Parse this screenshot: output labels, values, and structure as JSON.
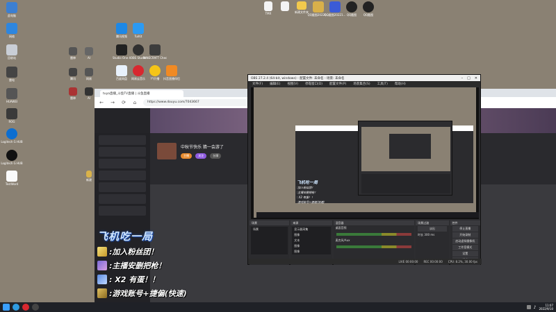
{
  "browser": {
    "tab_title": "tuya直播_斗鱼TV直播 | 斗鱼直播",
    "url": "https://www.douyu.com/7043667",
    "streamer_title": "中秋节快乐 猜一会游了",
    "pills": [
      "主播",
      "关注",
      "分享"
    ]
  },
  "overlay": {
    "title": "飞机吃一局",
    "lines": [
      ":加入粉丝团！",
      ":主播安删把枪！",
      ": X2 有蛋！！",
      ":游戏账号+捷偏(快速)"
    ]
  },
  "obs": {
    "window_title": "OBS 27.2.4 (64-bit, windows) - 配置文件: 未命名 - 场景: 未命名",
    "menu": [
      "文件(F)",
      "编辑(E)",
      "视图(V)",
      "停靠窗口(D)",
      "配置文件(P)",
      "场景集合(S)",
      "工具(T)",
      "帮助(H)"
    ],
    "docks": {
      "scenes": "场景",
      "sources": "来源",
      "mixer": "混音器",
      "transitions": "场景过渡",
      "controls": "控件"
    },
    "scene_items": [
      "场景"
    ],
    "source_items": [
      "显示器采集",
      "图像",
      "文本",
      "图像",
      "图像"
    ],
    "mixer_channels": [
      "桌面音频",
      "麦克风/Aux"
    ],
    "transition_value": "淡出",
    "duration_label": "时长",
    "duration_value": "300 ms",
    "control_buttons": [
      "停止直播",
      "开始录制",
      "启动虚拟摄像机",
      "工作室模式",
      "设置",
      "退出"
    ],
    "status": [
      "LIVE 00:00:00",
      "REC 00:00:00",
      "CPU: 8.2%, 30.00 fps"
    ]
  },
  "desktop": {
    "top_icons": [
      "TMX",
      "",
      "新建文件夹",
      "QQ截图20220...",
      "QQ截图20221...",
      "QQ截图",
      "QQ截图"
    ],
    "mid_icons": [
      "腾讯视频",
      "TuiKit",
      "Studio One 4",
      "OBS Studio",
      "MINECRAFT Check",
      "百度网盘",
      "网易云音乐",
      "YY开播",
      "抖音直播伴侣"
    ],
    "left_icons": [
      "此电脑",
      "网络",
      "回收站",
      "雷电",
      "HUAWEI",
      "ROG",
      "Logitech G HUB",
      "TestWord"
    ],
    "small_icons": [
      "雷神",
      "AI",
      "腾讯",
      "网易"
    ],
    "file_label": "新建"
  },
  "taskbar": {
    "time": "11:07",
    "date": "2022/9/10"
  },
  "colors": {
    "desktop_bg": "#8a8173",
    "overlay_title": "#cfe6ff",
    "obs_bg": "#2d2d30"
  }
}
